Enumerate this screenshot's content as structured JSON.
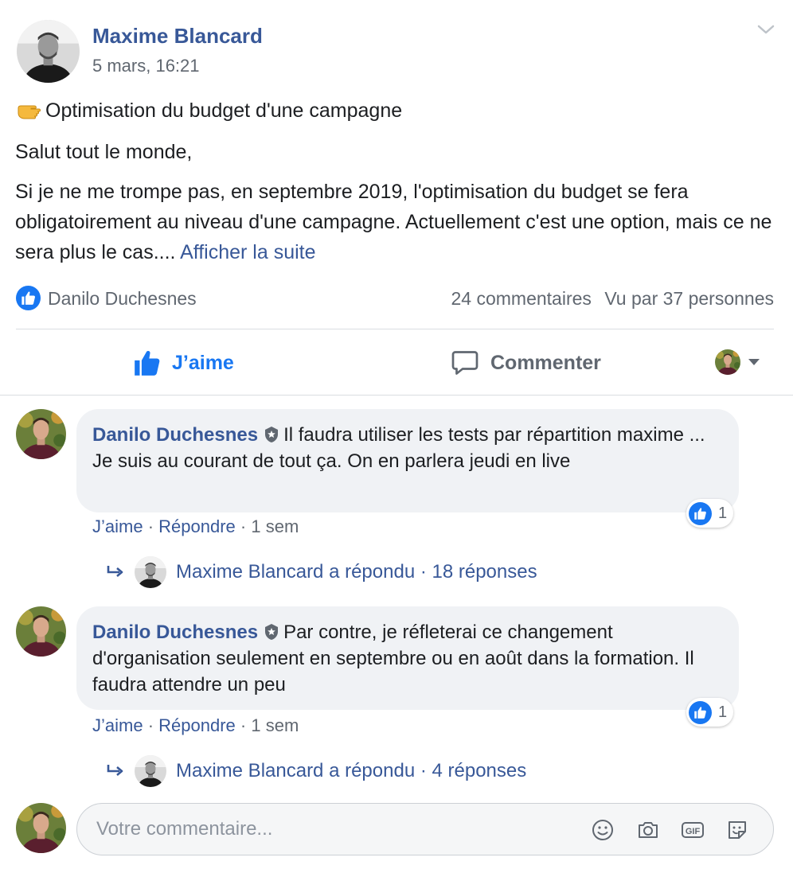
{
  "post": {
    "author": "Maxime Blancard",
    "time": "5 mars, 16:21",
    "title": "Optimisation du budget d'une campagne",
    "greeting": "Salut tout le monde,",
    "body": "Si je ne me trompe pas, en septembre 2019, l'optimisation du budget se fera obligatoirement au niveau d'une campagne. Actuellement c'est une option, mais ce ne sera plus le cas....",
    "see_more": "Afficher la suite",
    "title_emoji": "pointing-hand-icon"
  },
  "reactions": {
    "reactor": "Danilo Duchesnes",
    "comments_count": "24 commentaires",
    "seen_by": "Vu par 37 personnes"
  },
  "actions": {
    "like": "J’aime",
    "comment": "Commenter"
  },
  "comments": [
    {
      "author": "Danilo Duchesnes",
      "text": "Il faudra utiliser les tests par répartition maxime ... Je suis au courant de tout ça. On en parlera jeudi en live",
      "like": "J’aime",
      "reply": "Répondre",
      "age": "1 sem",
      "reactions": "1",
      "reply_summary": "Maxime Blancard a répondu · 18 réponses"
    },
    {
      "author": "Danilo Duchesnes",
      "text": "Par contre, je réfleterai ce changement d'organisation seulement en septembre ou en août dans la formation. Il faudra attendre un peu",
      "like": "J’aime",
      "reply": "Répondre",
      "age": "1 sem",
      "reactions": "1",
      "reply_summary": "Maxime Blancard a répondu · 4 réponses"
    }
  ],
  "composer": {
    "placeholder": "Votre commentaire...",
    "gif_label": "GIF"
  },
  "colors": {
    "link": "#385898",
    "like_blue": "#1877f2",
    "secondary_text": "#606770",
    "bubble_bg": "#f0f2f5"
  }
}
